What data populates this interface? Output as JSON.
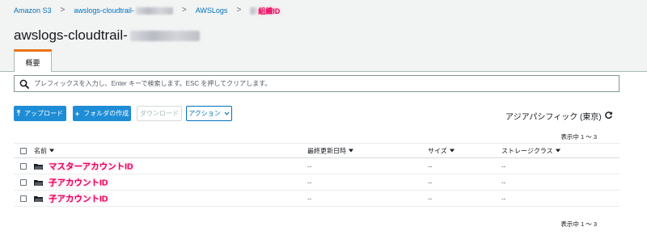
{
  "breadcrumb": {
    "items": [
      "Amazon S3",
      "awslogs-cloudtrail-",
      "AWSLogs",
      "組織ID"
    ],
    "separator": ">"
  },
  "page_title": "awslogs-cloudtrail-",
  "tabs": [
    {
      "label": "概要",
      "active": true
    }
  ],
  "search": {
    "placeholder": "プレフィックスを入力し、Enter キーで検索します。ESC を押してクリアします。"
  },
  "toolbar": {
    "upload_label": "アップロード",
    "create_folder_label": "フォルダの作成",
    "download_label": "ダウンロード",
    "actions_label": "アクション"
  },
  "region": "アジアパシフィック (東京)",
  "display_count": "表示中 1 ～ 3",
  "table": {
    "columns": [
      "名前",
      "最終更新日時",
      "サイズ",
      "ストレージクラス"
    ],
    "rows": [
      {
        "name": "マスターアカウントID",
        "modified": "--",
        "size": "--",
        "storage": "--"
      },
      {
        "name": "子アカウントID",
        "modified": "--",
        "size": "--",
        "storage": "--"
      },
      {
        "name": "子アカウントID",
        "modified": "--",
        "size": "--",
        "storage": "--"
      }
    ]
  },
  "colors": {
    "link": "#0073bb",
    "primary_button": "#1f8dd6",
    "tab_accent": "#ec7211",
    "highlight_label": "#e8005a",
    "header_background": "#f2f3f3"
  },
  "icons": [
    "search-icon",
    "upload-icon",
    "plus-icon",
    "chevron-down-icon",
    "refresh-icon",
    "folder-icon",
    "sort-caret-icon"
  ]
}
